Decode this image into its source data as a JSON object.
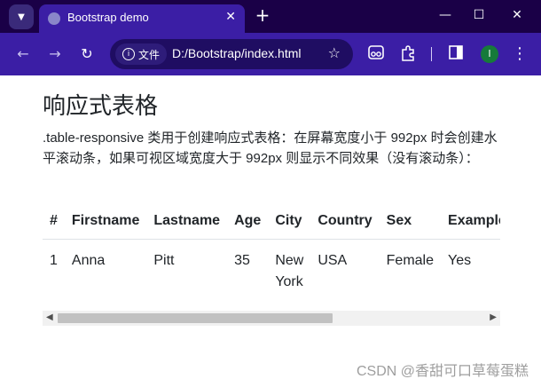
{
  "tab": {
    "title": "Bootstrap demo",
    "close_glyph": "✕"
  },
  "window": {
    "new_tab": "+",
    "minimize": "—",
    "maximize": "☐",
    "close": "✕"
  },
  "toolbar": {
    "back": "←",
    "forward": "→",
    "reload": "↻",
    "site_info_label": "文件",
    "url": "D:/Bootstrap/index.html",
    "star": "☆",
    "avatar_letter": "I",
    "menu": "⋮"
  },
  "page": {
    "heading": "响应式表格",
    "description": ".table-responsive 类用于创建响应式表格：在屏幕宽度小于 992px 时会创建水平滚动条，如果可视区域宽度大于 992px 则显示不同效果（没有滚动条）：",
    "table": {
      "headers": [
        "#",
        "Firstname",
        "Lastname",
        "Age",
        "City",
        "Country",
        "Sex",
        "Example"
      ],
      "rows": [
        [
          "1",
          "Anna",
          "Pitt",
          "35",
          "New York",
          "USA",
          "Female",
          "Yes"
        ]
      ]
    }
  },
  "watermark": "CSDN @香甜可口草莓蛋糕",
  "colors": {
    "titlebar": "#1a0047",
    "toolbar": "#3b1ea5",
    "omnibox": "#1f0d62"
  }
}
